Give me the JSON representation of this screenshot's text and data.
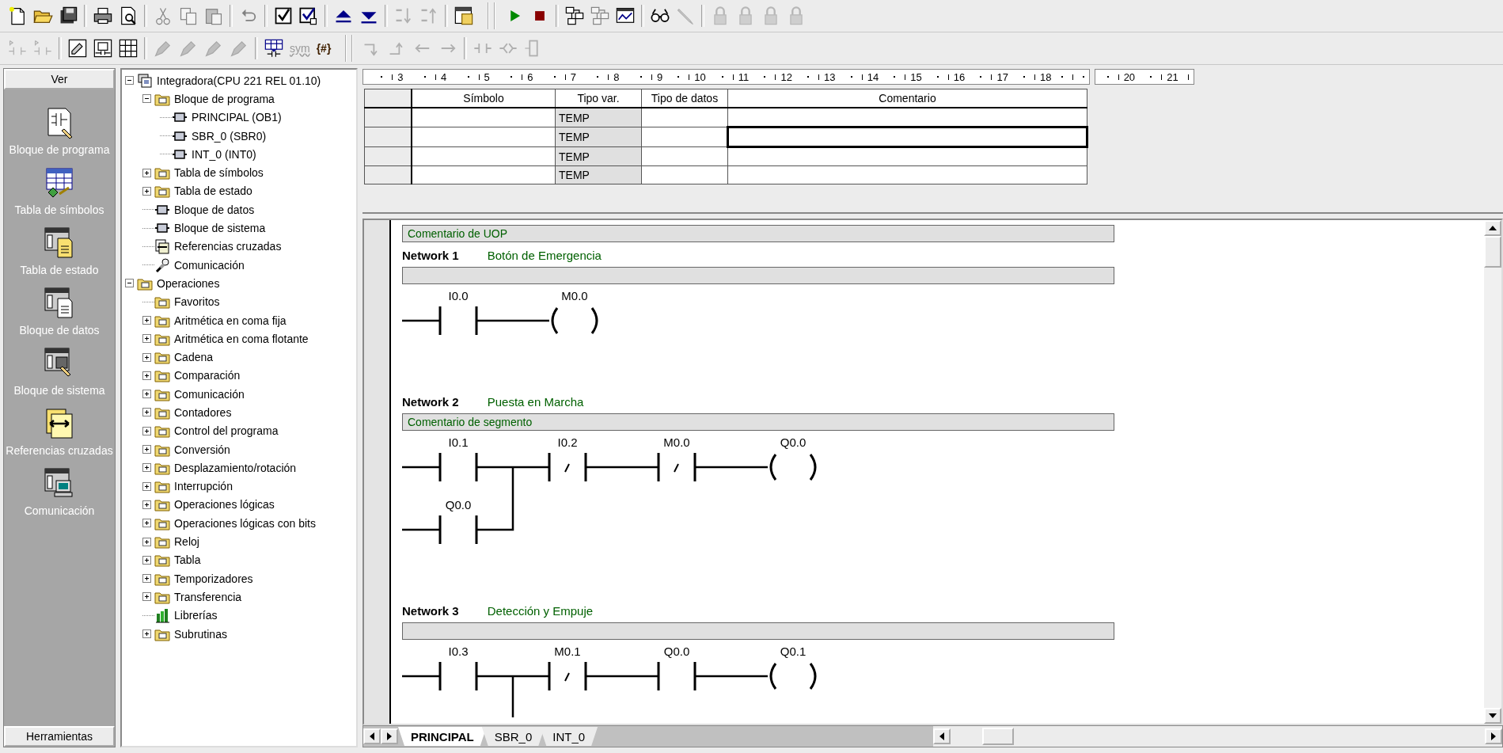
{
  "toolbars": [
    [
      {
        "kind": "new",
        "disabled": false
      },
      {
        "kind": "open",
        "disabled": false
      },
      {
        "kind": "save",
        "disabled": false
      },
      {
        "kind": "sep"
      },
      {
        "kind": "print",
        "disabled": false
      },
      {
        "kind": "preview",
        "disabled": false
      },
      {
        "kind": "sep"
      },
      {
        "kind": "cut",
        "disabled": true
      },
      {
        "kind": "copy",
        "disabled": true
      },
      {
        "kind": "paste",
        "disabled": true
      },
      {
        "kind": "sep"
      },
      {
        "kind": "undo",
        "disabled": true
      },
      {
        "kind": "sep"
      },
      {
        "kind": "check",
        "disabled": false
      },
      {
        "kind": "checkall",
        "disabled": false
      },
      {
        "kind": "sep"
      },
      {
        "kind": "upload",
        "disabled": false
      },
      {
        "kind": "download",
        "disabled": false
      },
      {
        "kind": "sep"
      },
      {
        "kind": "sortdown",
        "disabled": true
      },
      {
        "kind": "sortup",
        "disabled": true
      },
      {
        "kind": "sep"
      },
      {
        "kind": "window",
        "disabled": false
      },
      {
        "kind": "grip"
      },
      {
        "kind": "run",
        "disabled": false
      },
      {
        "kind": "stop",
        "disabled": false
      },
      {
        "kind": "sep"
      },
      {
        "kind": "network",
        "disabled": false
      },
      {
        "kind": "network",
        "disabled": true
      },
      {
        "kind": "chart",
        "disabled": false
      },
      {
        "kind": "sep"
      },
      {
        "kind": "glasses",
        "disabled": false
      },
      {
        "kind": "pencil",
        "disabled": true
      },
      {
        "kind": "sep"
      },
      {
        "kind": "lock",
        "disabled": true
      },
      {
        "kind": "lock",
        "disabled": true
      },
      {
        "kind": "lock",
        "disabled": true
      },
      {
        "kind": "lock",
        "disabled": true
      }
    ],
    [
      {
        "kind": "contact",
        "disabled": true
      },
      {
        "kind": "contact",
        "disabled": true
      },
      {
        "kind": "sep"
      },
      {
        "kind": "ladder",
        "disabled": false
      },
      {
        "kind": "fbd",
        "disabled": false
      },
      {
        "kind": "stl",
        "disabled": false
      },
      {
        "kind": "sep"
      },
      {
        "kind": "pen",
        "disabled": true
      },
      {
        "kind": "pen",
        "disabled": true
      },
      {
        "kind": "pen",
        "disabled": true
      },
      {
        "kind": "pen",
        "disabled": true
      },
      {
        "kind": "sep"
      },
      {
        "kind": "table",
        "disabled": false
      },
      {
        "kind": "text",
        "label": "sym",
        "disabled": true
      },
      {
        "kind": "text",
        "label": "{#}",
        "disabled": false
      },
      {
        "kind": "grip"
      },
      {
        "kind": "linedown",
        "disabled": true
      },
      {
        "kind": "lineup",
        "disabled": true
      },
      {
        "kind": "left",
        "disabled": true
      },
      {
        "kind": "right",
        "disabled": true
      },
      {
        "kind": "sep"
      },
      {
        "kind": "contactsym",
        "disabled": true
      },
      {
        "kind": "boxsym",
        "disabled": true
      },
      {
        "kind": "coilsym",
        "disabled": true
      }
    ]
  ],
  "sidebar": {
    "title": "Ver",
    "footer": "Herramientas",
    "items": [
      {
        "kind": "program",
        "label": "Bloque de programa"
      },
      {
        "kind": "symbols",
        "label": "Tabla de símbolos"
      },
      {
        "kind": "status",
        "label": "Tabla de estado"
      },
      {
        "kind": "data",
        "label": "Bloque de datos"
      },
      {
        "kind": "system",
        "label": "Bloque de sistema"
      },
      {
        "kind": "crossref",
        "label": "Referencias cruzadas"
      },
      {
        "kind": "comm",
        "label": "Comunicación"
      }
    ]
  },
  "tree": [
    {
      "kind": "project",
      "label": "Integradora(CPU 221 REL 01.10)",
      "expanded": true,
      "children": [
        {
          "kind": "folder",
          "label": "Bloque de programa",
          "expanded": true,
          "children": [
            {
              "kind": "block",
              "label": "PRINCIPAL (OB1)"
            },
            {
              "kind": "block",
              "label": "SBR_0 (SBR0)"
            },
            {
              "kind": "block",
              "label": "INT_0 (INT0)"
            }
          ]
        },
        {
          "kind": "folder",
          "label": "Tabla de símbolos",
          "expanded": false
        },
        {
          "kind": "folder",
          "label": "Tabla de estado",
          "expanded": false
        },
        {
          "kind": "block",
          "label": "Bloque de datos"
        },
        {
          "kind": "block",
          "label": "Bloque de sistema"
        },
        {
          "kind": "crossref",
          "label": "Referencias cruzadas"
        },
        {
          "kind": "plug",
          "label": "Comunicación"
        }
      ]
    },
    {
      "kind": "folder",
      "label": "Operaciones",
      "expanded": true,
      "children": [
        {
          "kind": "folder",
          "label": "Favoritos"
        },
        {
          "kind": "folder",
          "label": "Aritmética en coma fija",
          "expanded": false
        },
        {
          "kind": "folder",
          "label": "Aritmética en coma flotante",
          "expanded": false
        },
        {
          "kind": "folder",
          "label": "Cadena",
          "expanded": false
        },
        {
          "kind": "folder",
          "label": "Comparación",
          "expanded": false
        },
        {
          "kind": "folder",
          "label": "Comunicación",
          "expanded": false
        },
        {
          "kind": "folder",
          "label": "Contadores",
          "expanded": false
        },
        {
          "kind": "folder",
          "label": "Control del programa",
          "expanded": false
        },
        {
          "kind": "folder",
          "label": "Conversión",
          "expanded": false
        },
        {
          "kind": "folder",
          "label": "Desplazamiento/rotación",
          "expanded": false
        },
        {
          "kind": "folder",
          "label": "Interrupción",
          "expanded": false
        },
        {
          "kind": "folder",
          "label": "Operaciones lógicas",
          "expanded": false
        },
        {
          "kind": "folder",
          "label": "Operaciones lógicas con bits",
          "expanded": false
        },
        {
          "kind": "folder",
          "label": "Reloj",
          "expanded": false
        },
        {
          "kind": "folder",
          "label": "Tabla",
          "expanded": false
        },
        {
          "kind": "folder",
          "label": "Temporizadores",
          "expanded": false
        },
        {
          "kind": "folder",
          "label": "Transferencia",
          "expanded": false
        },
        {
          "kind": "library",
          "label": "Librerías"
        },
        {
          "kind": "folder",
          "label": "Subrutinas",
          "expanded": false
        }
      ]
    }
  ],
  "ruler": {
    "marks": [
      "3",
      "4",
      "5",
      "6",
      "7",
      "8",
      "9",
      "10",
      "11",
      "12",
      "13",
      "14",
      "15",
      "16",
      "17",
      "18"
    ],
    "marks_after": [
      "20",
      "21"
    ]
  },
  "variable_table": {
    "columns": [
      "Símbolo",
      "Tipo var.",
      "Tipo de datos",
      "Comentario"
    ],
    "rows": [
      {
        "var_type": "TEMP",
        "focused": false
      },
      {
        "var_type": "TEMP",
        "focused": true
      },
      {
        "var_type": "TEMP",
        "focused": false
      },
      {
        "var_type": "TEMP",
        "focused": false
      }
    ]
  },
  "program": {
    "comment": "Comentario de UOP",
    "networks": [
      {
        "title": "Network 1",
        "name": "Botón de Emergencia",
        "branch": false,
        "rungs": [
          [
            {
              "kind": "no",
              "label": "I0.0"
            },
            {
              "kind": "coil",
              "label": "M0.0"
            }
          ]
        ]
      },
      {
        "title": "Network 2",
        "name": "Puesta en Marcha",
        "comment": "Comentario de segmento",
        "branch": true,
        "rungs": [
          [
            {
              "kind": "no",
              "label": "I0.1"
            },
            {
              "kind": "nc",
              "label": "I0.2"
            },
            {
              "kind": "nc",
              "label": "M0.0"
            },
            {
              "kind": "coil",
              "label": "Q0.0"
            }
          ],
          [
            {
              "kind": "no",
              "label": "Q0.0"
            }
          ]
        ]
      },
      {
        "title": "Network 3",
        "name": "Detección y Empuje",
        "branch": true,
        "rungs": [
          [
            {
              "kind": "no",
              "label": "I0.3"
            },
            {
              "kind": "nc",
              "label": "M0.1"
            },
            {
              "kind": "no",
              "label": "Q0.0"
            },
            {
              "kind": "coil",
              "label": "Q0.1"
            }
          ]
        ]
      }
    ]
  },
  "tabs": [
    {
      "label": "PRINCIPAL",
      "selected": true
    },
    {
      "label": "SBR_0",
      "selected": false
    },
    {
      "label": "INT_0",
      "selected": false
    }
  ]
}
